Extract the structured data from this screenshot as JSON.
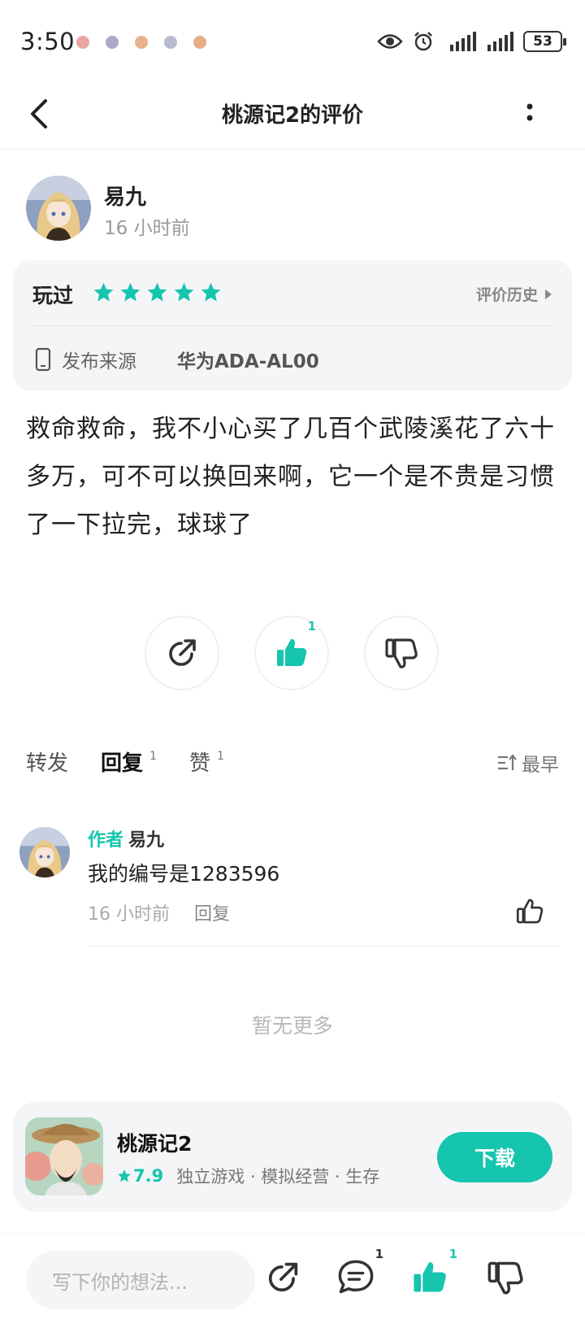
{
  "status_bar": {
    "time": "3:50",
    "battery": "53"
  },
  "header": {
    "title": "桃源记2的评价"
  },
  "review": {
    "author_name": "易九",
    "time_ago": "16 小时前",
    "played_label": "玩过",
    "stars": 5,
    "history_label": "评价历史",
    "source_label": "发布来源",
    "source_device": "华为ADA-AL00",
    "text": "救命救命，我不小心买了几百个武陵溪花了六十多万，可不可以换回来啊，它一个是不贵是习惯了一下拉完，球球了"
  },
  "actions": {
    "like_count": "1"
  },
  "tabs": [
    {
      "label": "转发",
      "count": ""
    },
    {
      "label": "回复",
      "count": "1"
    },
    {
      "label": "赞",
      "count": "1"
    }
  ],
  "sort_label": "最早",
  "comment": {
    "author_tag": "作者",
    "author_name": "易九",
    "text": "我的编号是1283596",
    "time_ago": "16 小时前",
    "reply_label": "回复"
  },
  "no_more_label": "暂无更多",
  "game": {
    "name": "桃源记2",
    "rating": "7.9",
    "tags": "独立游戏 · 模拟经营 · 生存",
    "download_label": "下载"
  },
  "bottom_bar": {
    "input_placeholder": "写下你的想法...",
    "comment_count": "1",
    "like_count": "1"
  },
  "colors": {
    "accent": "#15c5ae",
    "card_bg": "#f4f5f7"
  }
}
